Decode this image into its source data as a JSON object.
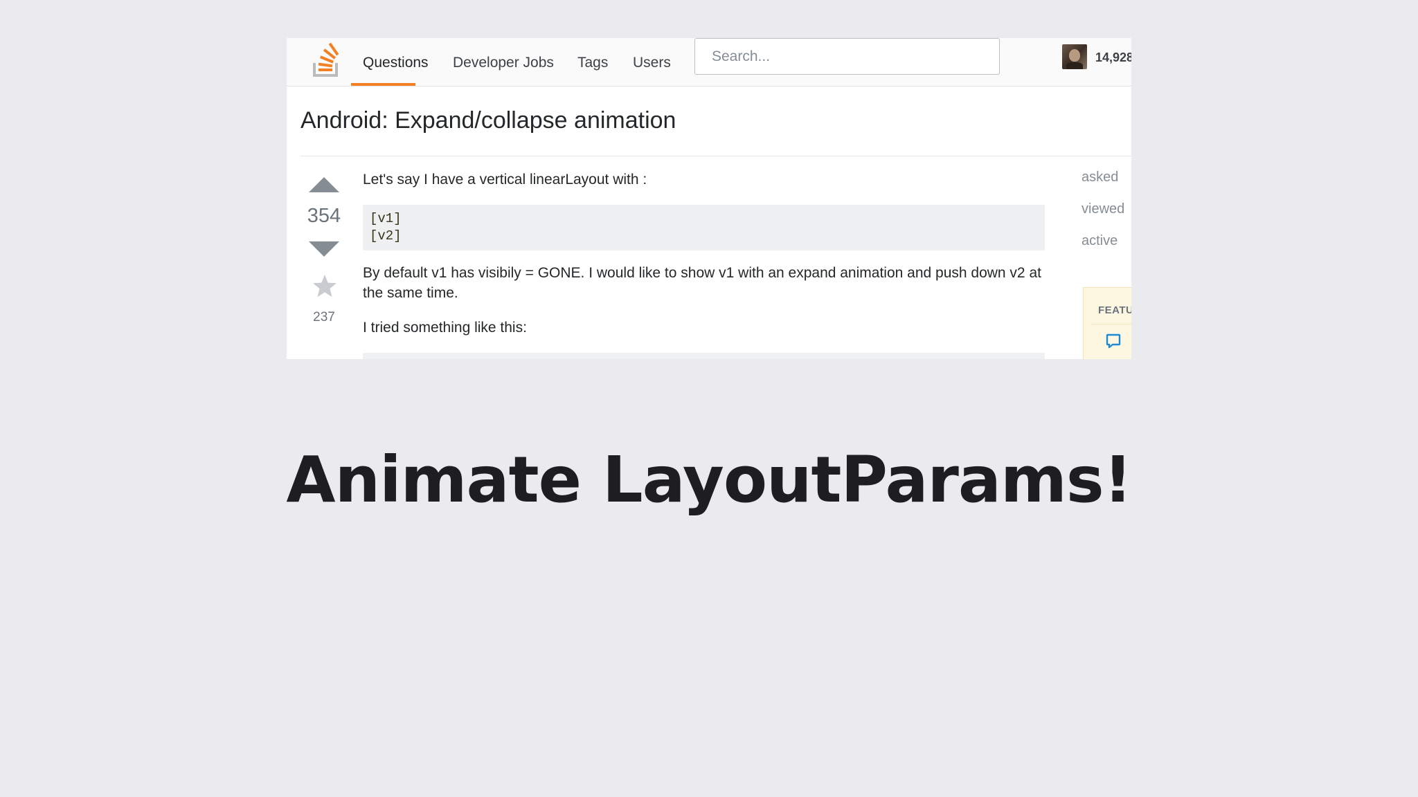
{
  "nav": {
    "logo_icon": "stack-overflow-logo",
    "items": [
      {
        "label": "Questions",
        "active": true
      },
      {
        "label": "Developer Jobs",
        "active": false
      },
      {
        "label": "Tags",
        "active": false
      },
      {
        "label": "Users",
        "active": false
      }
    ],
    "search_placeholder": "Search...",
    "user": {
      "avatar_icon": "user-avatar",
      "reputation": "14,928"
    },
    "accent_color": "#f48024"
  },
  "question": {
    "title": "Android: Expand/collapse animation",
    "score": "354",
    "favorites": "237",
    "paragraph_1": "Let's say I have a vertical linearLayout with :",
    "code_lines": [
      "[v1]",
      "[v2]"
    ],
    "paragraph_2": "By default v1 has visibily = GONE. I would like to show v1 with an expand animation and push down v2 at the same time.",
    "paragraph_3": "I tried something like this:"
  },
  "meta": {
    "asked": "asked",
    "viewed": "viewed",
    "active": "active"
  },
  "featured": {
    "title": "FEATU",
    "icon": "chat-bubble-icon"
  },
  "headline": "Animate LayoutParams!"
}
